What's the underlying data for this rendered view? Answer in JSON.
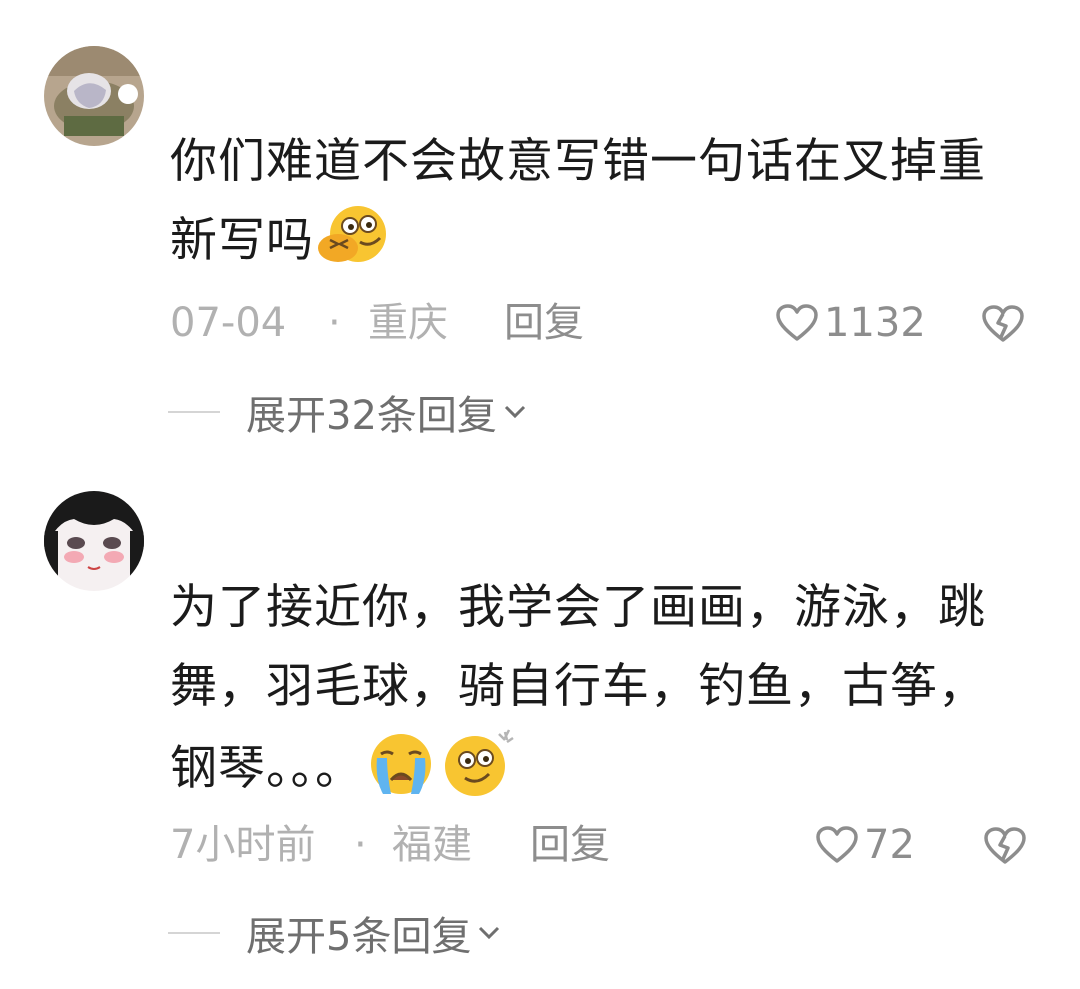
{
  "comments": [
    {
      "text": "你们难道不会故意写错一句话在叉掉重新写吗",
      "date": "07-04",
      "separator": "·",
      "location": "重庆",
      "reply_label": "回复",
      "likes": "1132",
      "expand_label": "展开32条回复",
      "emojis": [
        "grinning-hand-over-mouth-emoji"
      ]
    },
    {
      "text": "为了接近你，我学会了画画，游泳，跳舞，羽毛球，骑自行车，钓鱼，古筝，钢琴。。。",
      "date": "7小时前",
      "separator": "·",
      "location": "福建",
      "reply_label": "回复",
      "likes": "72",
      "expand_label": "展开5条回复",
      "emojis": [
        "loudly-crying-emoji",
        "dizzy-face-emoji"
      ]
    }
  ],
  "colors": {
    "text": "#1b1b1b",
    "meta": "#b1b1b1",
    "action": "#8d8d8d",
    "emoji_yellow": "#f8c531"
  },
  "icons": [
    "heart-outline-icon",
    "broken-heart-icon",
    "chevron-down-icon"
  ]
}
